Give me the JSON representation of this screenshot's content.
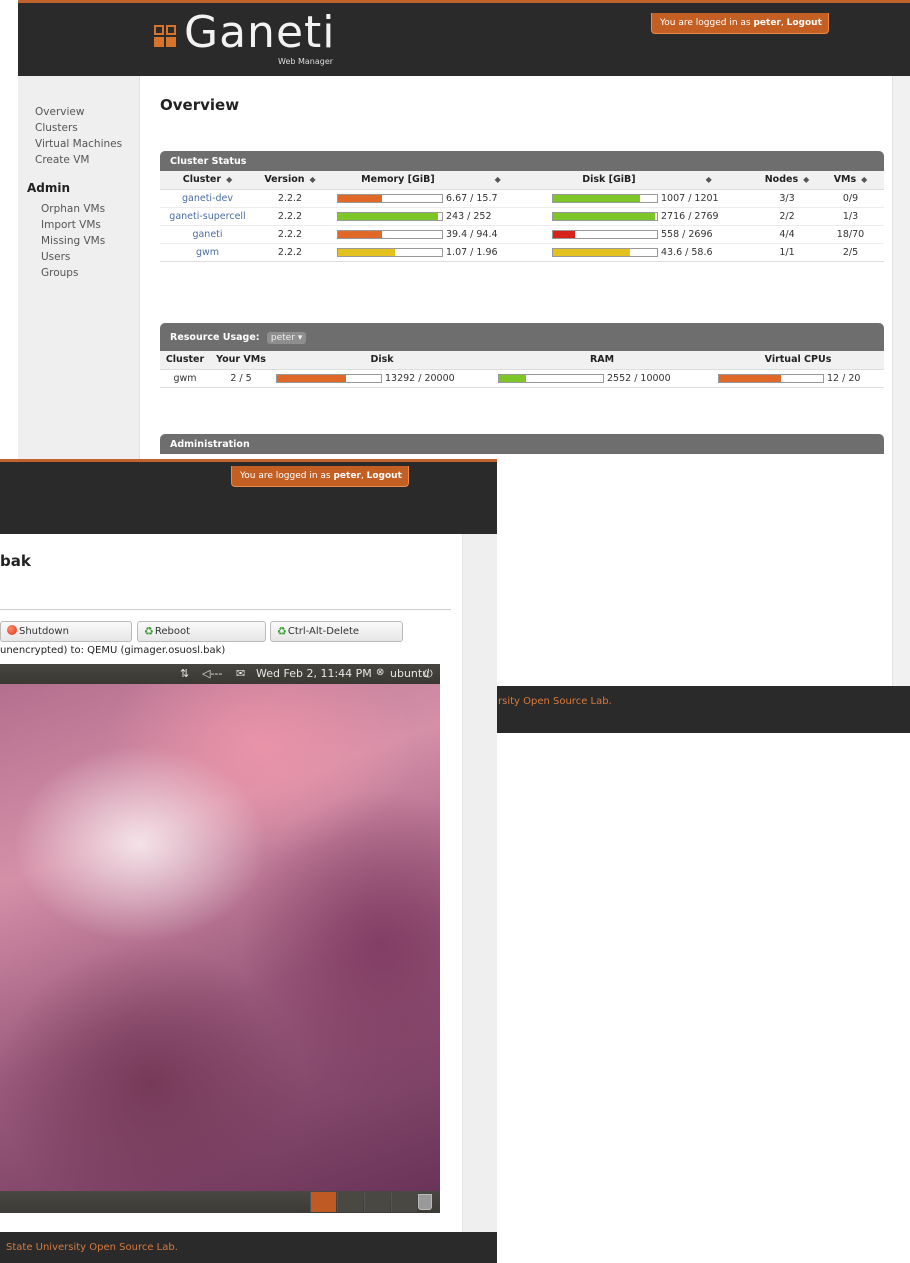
{
  "overview_window": {
    "brand": {
      "name": "Ganeti",
      "subtitle": "Web Manager"
    },
    "login": {
      "prefix": "You are logged in as",
      "user": "peter",
      "logout": "Logout"
    },
    "sidebar": {
      "items": [
        "Overview",
        "Clusters",
        "Virtual Machines",
        "Create VM"
      ],
      "admin_heading": "Admin",
      "admin_items": [
        "Orphan VMs",
        "Import VMs",
        "Missing VMs",
        "Users",
        "Groups"
      ]
    },
    "page_title": "Overview",
    "cluster_status": {
      "title": "Cluster Status",
      "headers": [
        "Cluster",
        "Version",
        "Memory [GiB]",
        "Disk [GiB]",
        "Nodes",
        "VMs"
      ],
      "rows": [
        {
          "cluster": "ganeti-dev",
          "version": "2.2.2",
          "memory": "6.67 / 15.7",
          "memory_pct": 42,
          "memory_color": "#e0692a",
          "disk": "1007 / 1201",
          "disk_pct": 84,
          "disk_color": "#7cc627",
          "nodes": "3/3",
          "vms": "0/9"
        },
        {
          "cluster": "ganeti-supercell",
          "version": "2.2.2",
          "memory": "243 / 252",
          "memory_pct": 96,
          "memory_color": "#7cc627",
          "disk": "2716 / 2769",
          "disk_pct": 98,
          "disk_color": "#7cc627",
          "nodes": "2/2",
          "vms": "1/3"
        },
        {
          "cluster": "ganeti",
          "version": "2.2.2",
          "memory": "39.4 / 94.4",
          "memory_pct": 42,
          "memory_color": "#e0692a",
          "disk": "558 / 2696",
          "disk_pct": 21,
          "disk_color": "#d8231c",
          "nodes": "4/4",
          "vms": "18/70"
        },
        {
          "cluster": "gwm",
          "version": "2.2.2",
          "memory": "1.07 / 1.96",
          "memory_pct": 55,
          "memory_color": "#e3c21f",
          "disk": "43.6 / 58.6",
          "disk_pct": 74,
          "disk_color": "#e3c21f",
          "nodes": "1/1",
          "vms": "2/5"
        }
      ]
    },
    "resource_usage": {
      "title": "Resource Usage:",
      "user_select": "peter",
      "headers": [
        "Cluster",
        "Your VMs",
        "Disk",
        "RAM",
        "Virtual CPUs"
      ],
      "rows": [
        {
          "cluster": "gwm",
          "your_vms": "2 / 5",
          "disk": "13292 / 20000",
          "disk_pct": 66,
          "disk_color": "#e0692a",
          "ram": "2552 / 10000",
          "ram_pct": 26,
          "ram_color": "#7cc627",
          "vcpus": "12 / 20",
          "vcpus_pct": 60,
          "vcpus_color": "#e0692a"
        }
      ]
    },
    "administration": {
      "title": "Administration"
    },
    "footer": "rsity Open Source Lab."
  },
  "console_window": {
    "login": {
      "prefix": "You are logged in as",
      "user": "peter",
      "logout": "Logout"
    },
    "title_fragment": "bak",
    "buttons": {
      "shutdown": "Shutdown",
      "reboot": "Reboot",
      "ctrl_alt_delete": "Ctrl-Alt-Delete"
    },
    "connection_status": "unencrypted) to: QEMU (gimager.osuosl.bak)",
    "ubuntu_panel": {
      "network": "⇅",
      "volume": "◁---",
      "mail": "✉",
      "clock": "Wed Feb  2, 11:44 PM",
      "user": "ubuntu",
      "power": "⏻"
    },
    "footer": "State University Open Source Lab."
  },
  "colors": {
    "accent": "#c45f23",
    "topbar": "#2a2a2a",
    "panel_header": "#6e6e6e",
    "link": "#4a6ea3"
  }
}
